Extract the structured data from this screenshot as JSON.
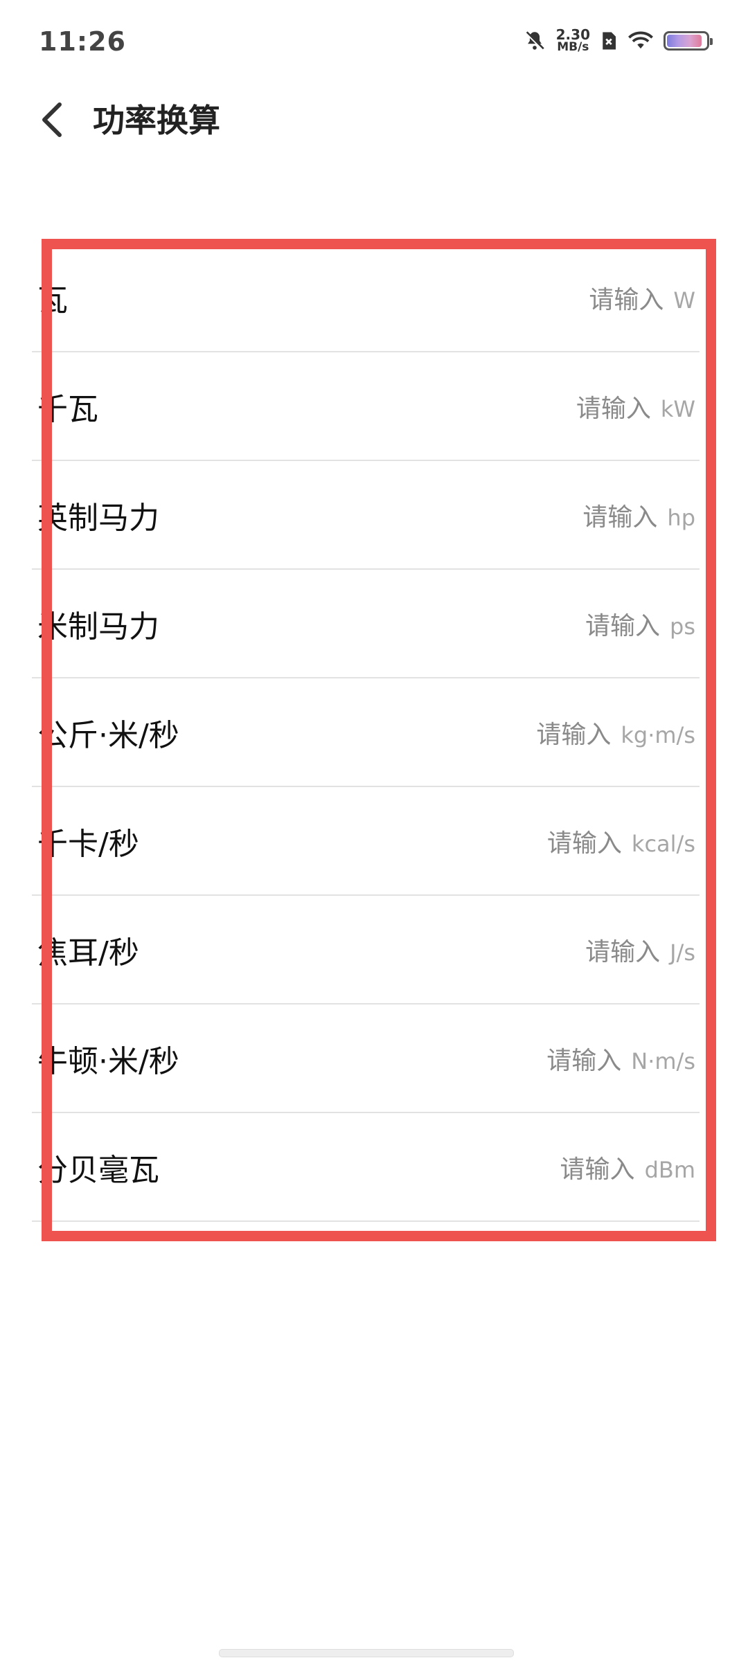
{
  "status_bar": {
    "time": "11:26",
    "net_speed_value": "2.30",
    "net_speed_unit": "MB/s",
    "icons": [
      "bell-muted-icon",
      "sim-error-icon",
      "wifi-icon",
      "battery-icon"
    ],
    "battery_level_pct": 90
  },
  "header": {
    "back_icon": "chevron-left-icon",
    "title": "功率换算"
  },
  "rows": [
    {
      "label": "瓦",
      "placeholder": "请输入",
      "unit": "W"
    },
    {
      "label": "千瓦",
      "placeholder": "请输入",
      "unit": "kW"
    },
    {
      "label": "英制马力",
      "placeholder": "请输入",
      "unit": "hp"
    },
    {
      "label": "米制马力",
      "placeholder": "请输入",
      "unit": "ps"
    },
    {
      "label": "公斤·米/秒",
      "placeholder": "请输入",
      "unit": "kg·m/s"
    },
    {
      "label": "千卡/秒",
      "placeholder": "请输入",
      "unit": "kcal/s"
    },
    {
      "label": "焦耳/秒",
      "placeholder": "请输入",
      "unit": "J/s"
    },
    {
      "label": "牛顿·米/秒",
      "placeholder": "请输入",
      "unit": "N·m/s"
    },
    {
      "label": "分贝毫瓦",
      "placeholder": "请输入",
      "unit": "dBm"
    }
  ],
  "colors": {
    "highlight": "#ef5350",
    "placeholder": "#8a8a8a",
    "unit": "#a6a6a6",
    "divider": "#e2e2e2"
  }
}
